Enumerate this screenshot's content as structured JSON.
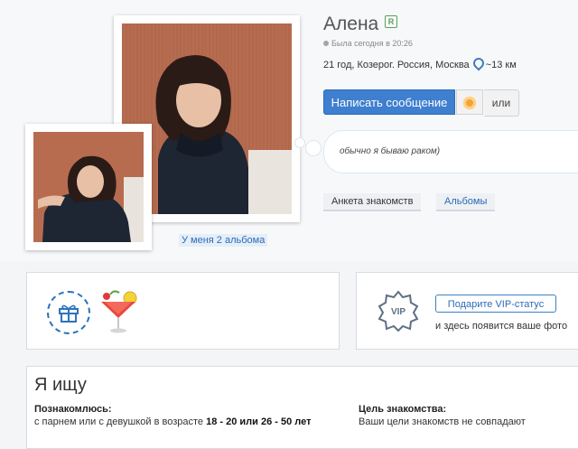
{
  "profile": {
    "name": "Алена",
    "badge": "R",
    "status": "Была сегодня в 20:26",
    "info": "21 год, Козерог. Россия, Москва",
    "distance": "~13 км",
    "about": "обычно я бываю раком)"
  },
  "photos": {
    "albums_link": "У меня 2 альбома"
  },
  "actions": {
    "write_message": "Написать сообщение",
    "or": "или"
  },
  "tabs": [
    {
      "label": "Анкета знакомств"
    },
    {
      "label": "Альбомы"
    }
  ],
  "vip": {
    "badge": "VIP",
    "button": "Подарите VIP-статус",
    "text": "и здесь появится ваше фото"
  },
  "seeking": {
    "title": "Я ищу",
    "meet_label": "Познакомлюсь:",
    "meet_text": "с парнем или с девушкой в возрасте",
    "meet_range": "18 - 20 или 26 - 50 лет",
    "goal_label": "Цель знакомства:",
    "goal_text": "Ваши цели знакомств не совпадают"
  },
  "colors": {
    "accent": "#3f7fcf",
    "link": "#2a6bb7",
    "photo_wall": "#b06a50"
  }
}
